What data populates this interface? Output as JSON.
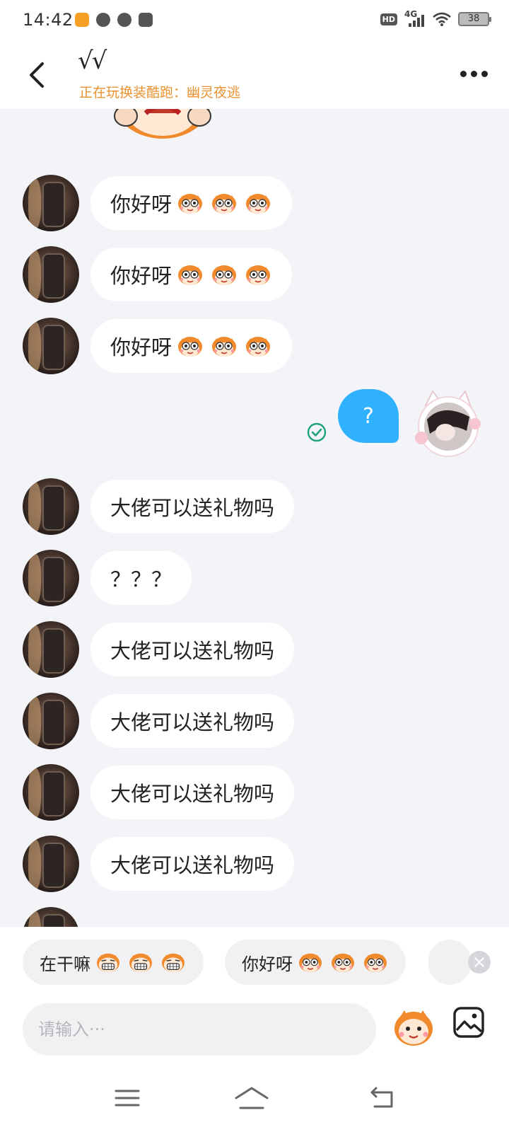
{
  "status_bar": {
    "time": "14:42",
    "app_icons": [
      "233-app-icon",
      "link-app-icon",
      "wechat-icon",
      "video-app-icon"
    ],
    "hd_label": "HD",
    "network_label": "4G",
    "battery_level": "38"
  },
  "header": {
    "title": "√√",
    "subtitle": "正在玩换装酷跑：幽灵夜逃"
  },
  "messages": [
    {
      "side": "left",
      "text": "你好呀",
      "emoji_count": 3
    },
    {
      "side": "left",
      "text": "你好呀",
      "emoji_count": 3
    },
    {
      "side": "left",
      "text": "你好呀",
      "emoji_count": 3
    },
    {
      "side": "right",
      "text": "?",
      "status": "read"
    },
    {
      "side": "left",
      "text": "大佬可以送礼物吗"
    },
    {
      "side": "left",
      "text": "？？？"
    },
    {
      "side": "left",
      "text": "大佬可以送礼物吗"
    },
    {
      "side": "left",
      "text": "大佬可以送礼物吗"
    },
    {
      "side": "left",
      "text": "大佬可以送礼物吗"
    },
    {
      "side": "left",
      "text": "大佬可以送礼物吗"
    }
  ],
  "quick_replies": [
    {
      "text": "在干嘛",
      "emoji_count": 3
    },
    {
      "text": "你好呀",
      "emoji_count": 3
    }
  ],
  "input": {
    "placeholder": "请输入···",
    "value": ""
  },
  "colors": {
    "accent": "#e89230",
    "self_bubble": "#2fb1ff",
    "chat_background": "#f3f4f8",
    "read_check": "#1fa37a"
  }
}
